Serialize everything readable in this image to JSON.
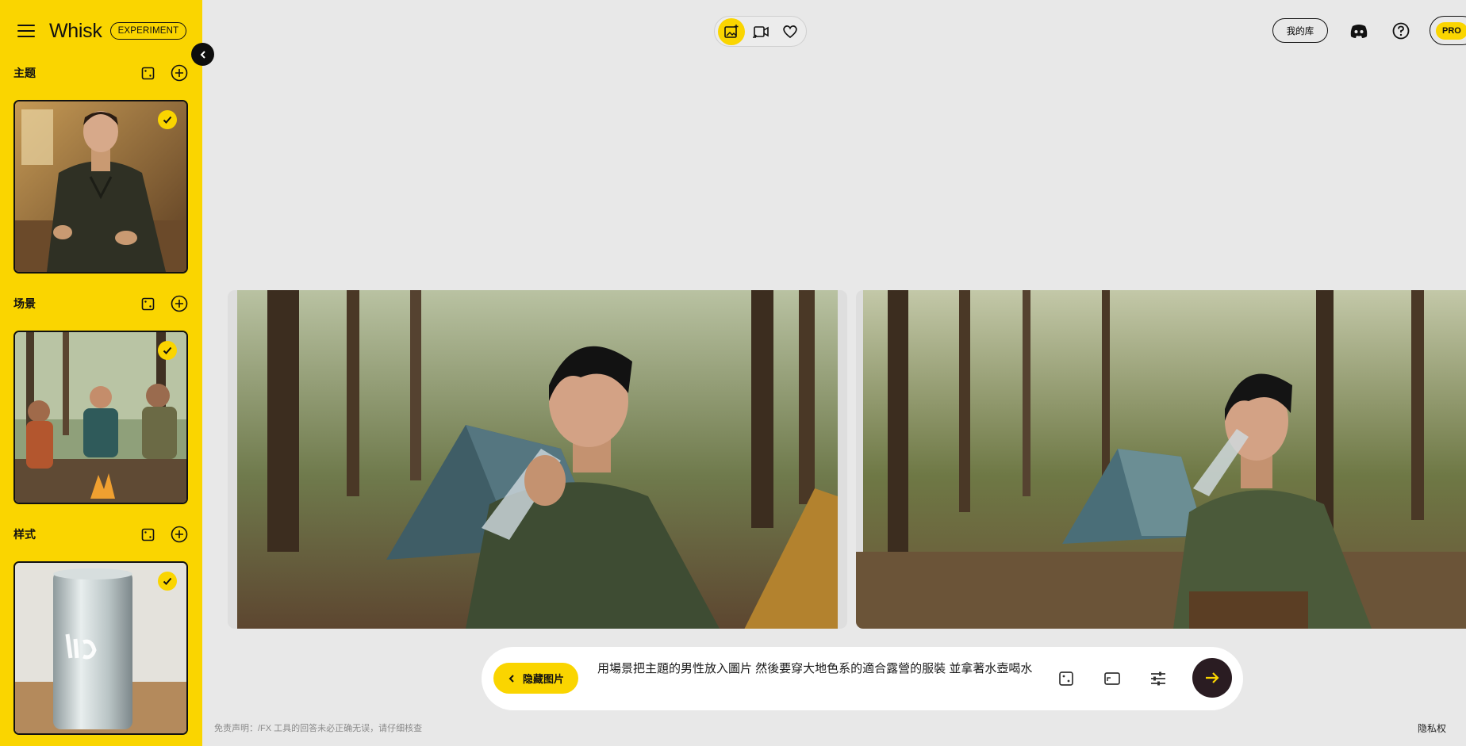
{
  "app": {
    "brand": "Whisk",
    "badge": "EXPERIMENT"
  },
  "sidebar": {
    "sections": [
      {
        "title": "主题",
        "card_selected": true,
        "card_image": "man cooking in kitchen illustration"
      },
      {
        "title": "场景",
        "card_selected": true,
        "card_image": "friends around campfire in forest"
      },
      {
        "title": "样式",
        "card_selected": true,
        "card_image": "silver can with Liquid text"
      }
    ]
  },
  "topbar": {
    "modes": [
      "image-mode",
      "video-mode",
      "favorites-mode"
    ],
    "active_mode": "image-mode",
    "library_label": "我的库",
    "pro_label": "PRO"
  },
  "results": {
    "images": [
      {
        "description": "young man drinking bottled water in forest campsite, close up"
      },
      {
        "description": "young man sitting and drinking bottled water near tent in forest"
      }
    ]
  },
  "prompt": {
    "hide_images_label": "隐藏图片",
    "text": "用場景把主題的男性放入圖片 然後要穿大地色系的適合露營的服裝 並拿著水壺喝水"
  },
  "footer": {
    "disclaimer": "免责声明：/FX 工具的回答未必正确无误，请仔细核查",
    "privacy": "隐私权"
  },
  "colors": {
    "accent": "#fad500",
    "background": "#e8e8e8",
    "dark": "#111111"
  }
}
